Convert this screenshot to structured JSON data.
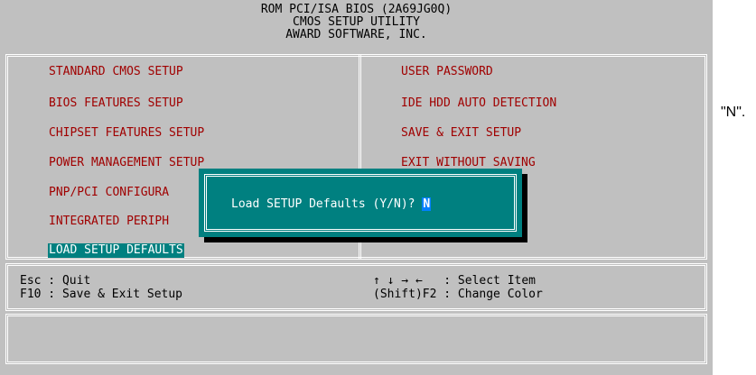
{
  "header": {
    "line1": "ROM PCI/ISA BIOS (2A69JG0Q)",
    "line2": "CMOS SETUP UTILITY",
    "line3": "AWARD SOFTWARE, INC."
  },
  "menu": {
    "left": [
      "STANDARD CMOS SETUP",
      "BIOS FEATURES SETUP",
      "CHIPSET FEATURES SETUP",
      "POWER MANAGEMENT SETUP",
      "PNP/PCI CONFIGURA",
      "INTEGRATED PERIPH",
      "LOAD SETUP DEFAULTS"
    ],
    "right": [
      "USER PASSWORD",
      "IDE HDD AUTO DETECTION",
      "SAVE & EXIT SETUP",
      "EXIT WITHOUT SAVING"
    ],
    "selected": "LOAD SETUP DEFAULTS"
  },
  "help": {
    "left1": "Esc : Quit",
    "left2": "F10 : Save & Exit Setup",
    "right1": "↑ ↓ → ←   : Select Item",
    "right2": "(Shift)F2 : Change Color"
  },
  "dialog": {
    "prompt": "Load SETUP Defaults (Y/N)? ",
    "answer": "N"
  },
  "side_text": "\"N\".",
  "colors": {
    "background": "#c0c0c0",
    "menu_text": "#a00000",
    "highlight": "#008080",
    "frame": "#ffffff"
  }
}
